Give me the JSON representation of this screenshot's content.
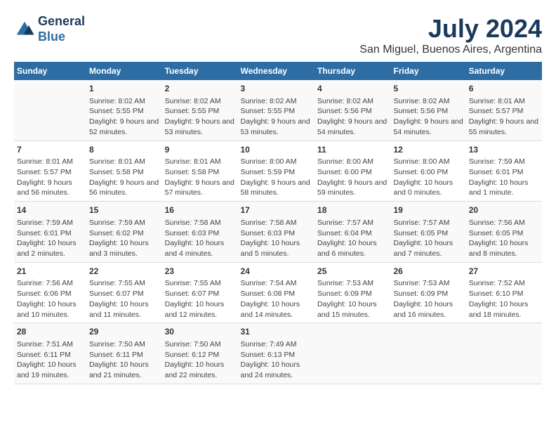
{
  "logo": {
    "line1": "General",
    "line2": "Blue"
  },
  "title": "July 2024",
  "subtitle": "San Miguel, Buenos Aires, Argentina",
  "days_header": [
    "Sunday",
    "Monday",
    "Tuesday",
    "Wednesday",
    "Thursday",
    "Friday",
    "Saturday"
  ],
  "weeks": [
    [
      {
        "day": "",
        "info": ""
      },
      {
        "day": "1",
        "info": "Sunrise: 8:02 AM\nSunset: 5:55 PM\nDaylight: 9 hours and 52 minutes."
      },
      {
        "day": "2",
        "info": "Sunrise: 8:02 AM\nSunset: 5:55 PM\nDaylight: 9 hours and 53 minutes."
      },
      {
        "day": "3",
        "info": "Sunrise: 8:02 AM\nSunset: 5:55 PM\nDaylight: 9 hours and 53 minutes."
      },
      {
        "day": "4",
        "info": "Sunrise: 8:02 AM\nSunset: 5:56 PM\nDaylight: 9 hours and 54 minutes."
      },
      {
        "day": "5",
        "info": "Sunrise: 8:02 AM\nSunset: 5:56 PM\nDaylight: 9 hours and 54 minutes."
      },
      {
        "day": "6",
        "info": "Sunrise: 8:01 AM\nSunset: 5:57 PM\nDaylight: 9 hours and 55 minutes."
      }
    ],
    [
      {
        "day": "7",
        "info": "Sunrise: 8:01 AM\nSunset: 5:57 PM\nDaylight: 9 hours and 56 minutes."
      },
      {
        "day": "8",
        "info": "Sunrise: 8:01 AM\nSunset: 5:58 PM\nDaylight: 9 hours and 56 minutes."
      },
      {
        "day": "9",
        "info": "Sunrise: 8:01 AM\nSunset: 5:58 PM\nDaylight: 9 hours and 57 minutes."
      },
      {
        "day": "10",
        "info": "Sunrise: 8:00 AM\nSunset: 5:59 PM\nDaylight: 9 hours and 58 minutes."
      },
      {
        "day": "11",
        "info": "Sunrise: 8:00 AM\nSunset: 6:00 PM\nDaylight: 9 hours and 59 minutes."
      },
      {
        "day": "12",
        "info": "Sunrise: 8:00 AM\nSunset: 6:00 PM\nDaylight: 10 hours and 0 minutes."
      },
      {
        "day": "13",
        "info": "Sunrise: 7:59 AM\nSunset: 6:01 PM\nDaylight: 10 hours and 1 minute."
      }
    ],
    [
      {
        "day": "14",
        "info": "Sunrise: 7:59 AM\nSunset: 6:01 PM\nDaylight: 10 hours and 2 minutes."
      },
      {
        "day": "15",
        "info": "Sunrise: 7:59 AM\nSunset: 6:02 PM\nDaylight: 10 hours and 3 minutes."
      },
      {
        "day": "16",
        "info": "Sunrise: 7:58 AM\nSunset: 6:03 PM\nDaylight: 10 hours and 4 minutes."
      },
      {
        "day": "17",
        "info": "Sunrise: 7:58 AM\nSunset: 6:03 PM\nDaylight: 10 hours and 5 minutes."
      },
      {
        "day": "18",
        "info": "Sunrise: 7:57 AM\nSunset: 6:04 PM\nDaylight: 10 hours and 6 minutes."
      },
      {
        "day": "19",
        "info": "Sunrise: 7:57 AM\nSunset: 6:05 PM\nDaylight: 10 hours and 7 minutes."
      },
      {
        "day": "20",
        "info": "Sunrise: 7:56 AM\nSunset: 6:05 PM\nDaylight: 10 hours and 8 minutes."
      }
    ],
    [
      {
        "day": "21",
        "info": "Sunrise: 7:56 AM\nSunset: 6:06 PM\nDaylight: 10 hours and 10 minutes."
      },
      {
        "day": "22",
        "info": "Sunrise: 7:55 AM\nSunset: 6:07 PM\nDaylight: 10 hours and 11 minutes."
      },
      {
        "day": "23",
        "info": "Sunrise: 7:55 AM\nSunset: 6:07 PM\nDaylight: 10 hours and 12 minutes."
      },
      {
        "day": "24",
        "info": "Sunrise: 7:54 AM\nSunset: 6:08 PM\nDaylight: 10 hours and 14 minutes."
      },
      {
        "day": "25",
        "info": "Sunrise: 7:53 AM\nSunset: 6:09 PM\nDaylight: 10 hours and 15 minutes."
      },
      {
        "day": "26",
        "info": "Sunrise: 7:53 AM\nSunset: 6:09 PM\nDaylight: 10 hours and 16 minutes."
      },
      {
        "day": "27",
        "info": "Sunrise: 7:52 AM\nSunset: 6:10 PM\nDaylight: 10 hours and 18 minutes."
      }
    ],
    [
      {
        "day": "28",
        "info": "Sunrise: 7:51 AM\nSunset: 6:11 PM\nDaylight: 10 hours and 19 minutes."
      },
      {
        "day": "29",
        "info": "Sunrise: 7:50 AM\nSunset: 6:11 PM\nDaylight: 10 hours and 21 minutes."
      },
      {
        "day": "30",
        "info": "Sunrise: 7:50 AM\nSunset: 6:12 PM\nDaylight: 10 hours and 22 minutes."
      },
      {
        "day": "31",
        "info": "Sunrise: 7:49 AM\nSunset: 6:13 PM\nDaylight: 10 hours and 24 minutes."
      },
      {
        "day": "",
        "info": ""
      },
      {
        "day": "",
        "info": ""
      },
      {
        "day": "",
        "info": ""
      }
    ]
  ]
}
